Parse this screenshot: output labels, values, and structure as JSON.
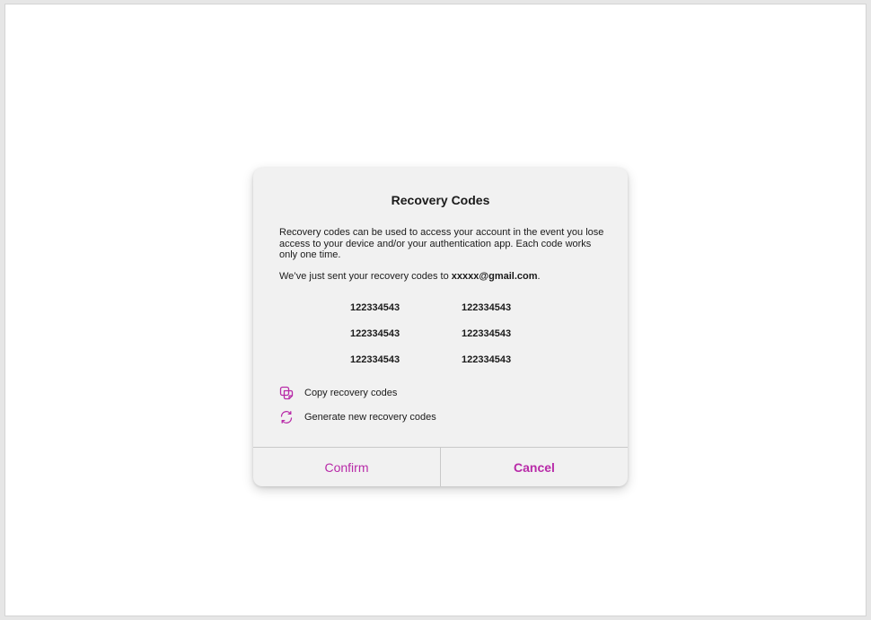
{
  "dialog": {
    "title": "Recovery Codes",
    "description": "Recovery codes can be used to access your account in the event you lose access to your device and/or your authentication app. Each code works only one time.",
    "sent_prefix": "We’ve just sent your recovery codes to ",
    "email": "xxxxx@gmail.com",
    "sent_suffix": ".",
    "codes": [
      "122334543",
      "122334543",
      "122334543",
      "122334543",
      "122334543",
      "122334543"
    ],
    "actions": {
      "copy": {
        "label": "Copy recovery codes",
        "icon": "copy-icon"
      },
      "generate": {
        "label": "Generate new recovery codes",
        "icon": "refresh-icon"
      }
    },
    "buttons": {
      "confirm": "Confirm",
      "cancel": "Cancel"
    }
  },
  "colors": {
    "accent": "#b82aa8",
    "dialog_bg": "#f1f1f1",
    "text": "#1a1a1a"
  }
}
